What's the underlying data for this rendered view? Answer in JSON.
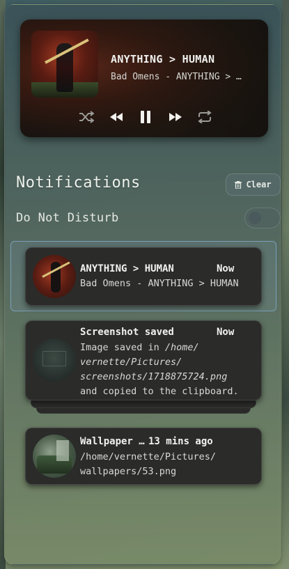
{
  "player": {
    "title": "ANYTHING > HUMAN",
    "artist": "Bad Omens - ANYTHING > …",
    "controls": [
      "shuffle-icon",
      "previous-icon",
      "pause-icon",
      "next-icon",
      "repeat-icon"
    ],
    "is_playing": true
  },
  "notifications": {
    "header": "Notifications",
    "clear_label": "Clear",
    "dnd_label": "Do Not Disturb",
    "dnd_enabled": false,
    "items": [
      {
        "app": "ANYTHING > HUMAN",
        "time": "Now",
        "body_line1": "Bad Omens - ANYTHING > HUMAN",
        "highlighted": true
      },
      {
        "app": "Screenshot saved",
        "time": "Now",
        "body_prefix": "Image saved in ",
        "body_path1": "/home/",
        "body_path2": "vernette/Pictures/",
        "body_path3": "screenshots/1718875724.png",
        "body_suffix": "and copied to the clipboard.",
        "stacked": true
      },
      {
        "app": "Wallpaper …",
        "time": "13 mins ago",
        "body_line1": "/home/vernette/Pictures/",
        "body_line2": "wallpapers/53.png"
      }
    ]
  },
  "colors": {
    "highlight_border": "#7aa0b8",
    "card_bg": "#2b2b2a",
    "text_primary": "#f1f1ee"
  }
}
